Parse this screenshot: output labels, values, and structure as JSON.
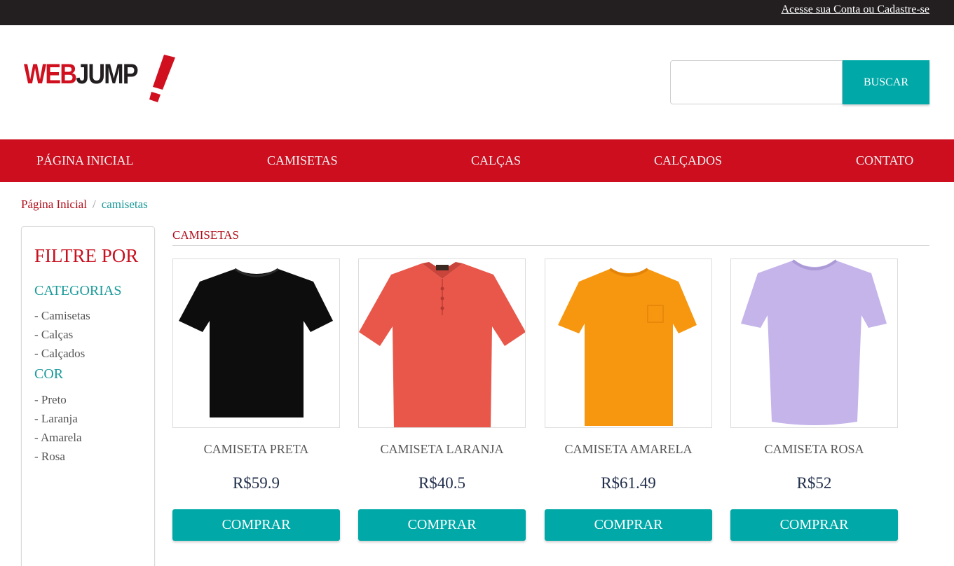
{
  "topbar": {
    "account_link": "Acesse sua Conta ou Cadastre-se"
  },
  "header": {
    "logo": {
      "part1": "WEB",
      "part2": "JUMP",
      "colors": {
        "red": "#d0101f",
        "dark": "#231f20"
      }
    },
    "search": {
      "placeholder": "",
      "value": "",
      "button_label": "BUSCAR"
    }
  },
  "nav": {
    "items": [
      {
        "label": "PÁGINA INICIAL"
      },
      {
        "label": "CAMISETAS"
      },
      {
        "label": "CALÇAS"
      },
      {
        "label": "CALÇADOS"
      },
      {
        "label": "CONTATO"
      }
    ]
  },
  "breadcrumb": {
    "home": "Página Inicial",
    "separator": "/",
    "current": "camisetas"
  },
  "sidebar": {
    "title": "FILTRE POR",
    "categories": {
      "title": "CATEGORIAS",
      "items": [
        "- Camisetas",
        "- Calças",
        "- Calçados"
      ]
    },
    "color": {
      "title": "COR",
      "items": [
        "- Preto",
        "- Laranja",
        "- Amarela",
        "- Rosa"
      ]
    }
  },
  "main": {
    "title": "CAMISETAS",
    "products": [
      {
        "name": "CAMISETA PRETA",
        "price": "R$59.9",
        "button": "COMPRAR",
        "image": "black-tshirt",
        "color": "#0d0d0d"
      },
      {
        "name": "CAMISETA LARANJA",
        "price": "R$40.5",
        "button": "COMPRAR",
        "image": "red-polo-shirt",
        "color": "#e8574a"
      },
      {
        "name": "CAMISETA AMARELA",
        "price": "R$61.49",
        "button": "COMPRAR",
        "image": "orange-tshirt",
        "color": "#f7970f"
      },
      {
        "name": "CAMISETA ROSA",
        "price": "R$52",
        "button": "COMPRAR",
        "image": "lavender-tshirt",
        "color": "#c4b4ea"
      }
    ]
  },
  "colors": {
    "teal": "#00a8a8",
    "red": "#cc0e1f",
    "dark": "#231f20"
  }
}
